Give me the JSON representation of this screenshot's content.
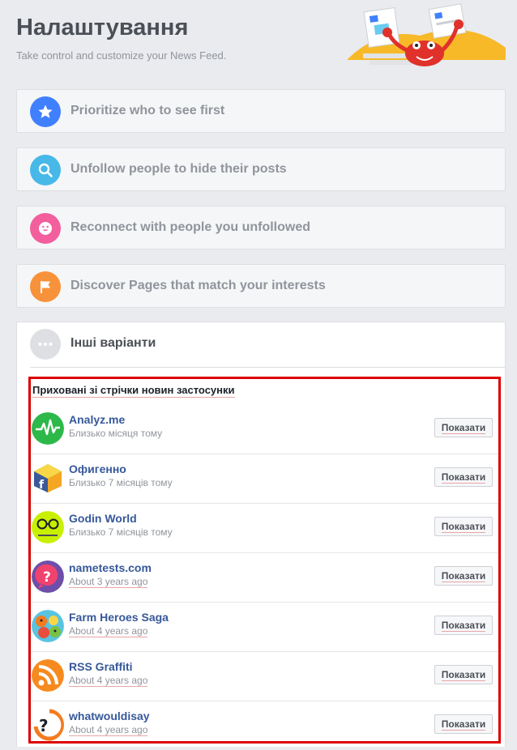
{
  "header": {
    "title": "Налаштування",
    "subtitle": "Take control and customize your News Feed."
  },
  "options": [
    {
      "label": "Prioritize who to see first",
      "icon": "star-icon",
      "color": "#4080ff"
    },
    {
      "label": "Unfollow people to hide their posts",
      "icon": "search-icon",
      "color": "#47b8e8"
    },
    {
      "label": "Reconnect with people you unfollowed",
      "icon": "smiley-icon",
      "color": "#f35369"
    },
    {
      "label": "Discover Pages that match your interests",
      "icon": "flag-icon",
      "color": "#f7923b"
    }
  ],
  "more": {
    "label": "Інші варіанти",
    "icon": "ellipsis-icon"
  },
  "hidden_apps": {
    "title": "Приховані зі стрічки новин застосунки",
    "button_label": "Показати",
    "items": [
      {
        "name": "Analyz.me",
        "time": "Близько місяця тому",
        "icon": "analyzme-icon"
      },
      {
        "name": "Офигенно",
        "time": "Близько 7 місяців тому",
        "icon": "ofigenno-icon"
      },
      {
        "name": "Godin World",
        "time": "Близько 7 місяців тому",
        "icon": "godin-world-icon"
      },
      {
        "name": "nametests.com",
        "time": "About 3 years ago",
        "icon": "nametests-icon"
      },
      {
        "name": "Farm Heroes Saga",
        "time": "About 4 years ago",
        "icon": "farm-heroes-icon"
      },
      {
        "name": "RSS Graffiti",
        "time": "About 4 years ago",
        "icon": "rss-graffiti-icon"
      },
      {
        "name": "whatwouldisay",
        "time": "About 4 years ago",
        "icon": "whatwouldisay-icon"
      }
    ]
  },
  "colors": {
    "highlight_border": "#dd0000",
    "link": "#365899",
    "page_bg": "#e9ebee"
  }
}
